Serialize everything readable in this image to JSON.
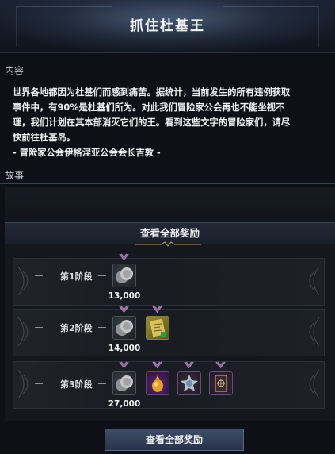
{
  "window": {
    "title": "抓住杜基王"
  },
  "content": {
    "heading": "内容",
    "lines": [
      "世界各地都因为杜基们而感到痛苦。据统计，当前发生的所有违例获取",
      "事件中，有90%是杜基们所为。对此我们冒险家公会再也不能坐视不",
      "理，我们计划在其本部消灭它们的王。看到这些文字的冒险家们，请尽",
      "快前往杜基岛。",
      "- 冒险家公会伊格涅亚公会会长吉敦 -"
    ]
  },
  "story": {
    "heading": "故事"
  },
  "rewards": {
    "header": "查看全部奖励",
    "stages": [
      {
        "label": "第1阶段",
        "items": [
          {
            "icon": "silver-coin-icon",
            "quantity": "13,000"
          }
        ]
      },
      {
        "label": "第2阶段",
        "items": [
          {
            "icon": "silver-coin-icon",
            "quantity": "14,000"
          },
          {
            "icon": "treasure-map-icon",
            "quantity": ""
          }
        ]
      },
      {
        "label": "第3阶段",
        "items": [
          {
            "icon": "silver-coin-icon",
            "quantity": "27,000"
          },
          {
            "icon": "golden-pouch-icon",
            "quantity": ""
          },
          {
            "icon": "silver-emblem-icon",
            "quantity": ""
          },
          {
            "icon": "dark-card-icon",
            "quantity": ""
          }
        ]
      }
    ],
    "button_label": "查看全部奖励"
  },
  "colors": {
    "background": "#0d1016",
    "accent": "#56688a",
    "badge": "#a07ab0"
  }
}
